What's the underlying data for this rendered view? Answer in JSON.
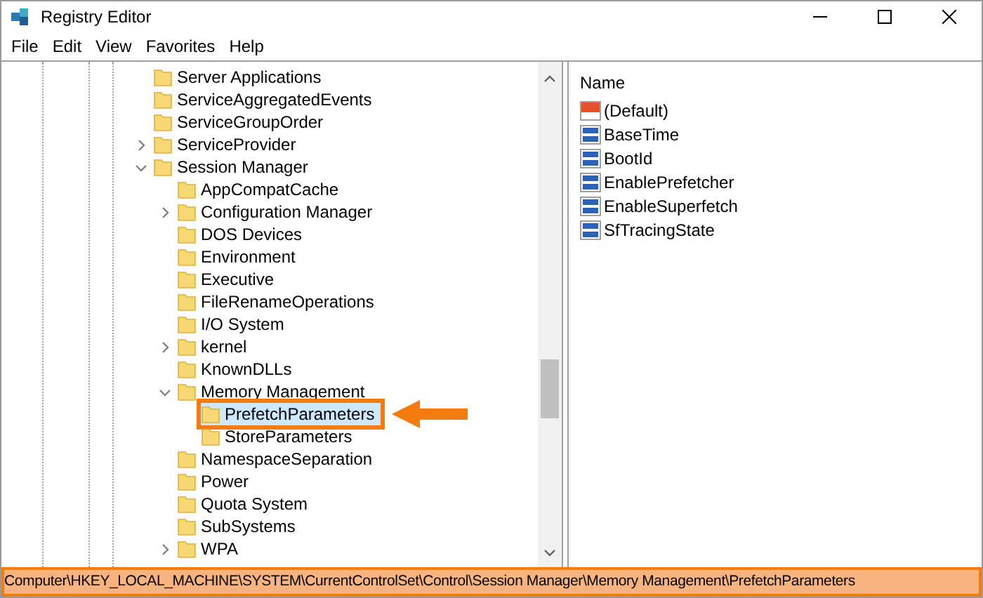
{
  "window": {
    "title": "Registry Editor"
  },
  "menu": [
    "File",
    "Edit",
    "View",
    "Favorites",
    "Help"
  ],
  "tree": [
    {
      "label": "Server Applications"
    },
    {
      "label": "ServiceAggregatedEvents"
    },
    {
      "label": "ServiceGroupOrder"
    },
    {
      "label": "ServiceProvider",
      "expanded": false
    },
    {
      "label": "Session Manager",
      "expanded": true,
      "children": [
        {
          "label": "AppCompatCache"
        },
        {
          "label": "Configuration Manager",
          "expanded": false
        },
        {
          "label": "DOS Devices"
        },
        {
          "label": "Environment"
        },
        {
          "label": "Executive"
        },
        {
          "label": "FileRenameOperations"
        },
        {
          "label": "I/O System"
        },
        {
          "label": "kernel",
          "expanded": false
        },
        {
          "label": "KnownDLLs"
        },
        {
          "label": "Memory Management",
          "expanded": true,
          "children": [
            {
              "label": "PrefetchParameters",
              "selected": true
            },
            {
              "label": "StoreParameters",
              "selected": false
            }
          ]
        },
        {
          "label": "NamespaceSeparation"
        },
        {
          "label": "Power"
        },
        {
          "label": "Quota System"
        },
        {
          "label": "SubSystems"
        },
        {
          "label": "WPA",
          "expanded": false
        }
      ]
    }
  ],
  "values": {
    "column": "Name",
    "rows": [
      {
        "kind": "string",
        "name": "(Default)"
      },
      {
        "kind": "binary",
        "name": "BaseTime"
      },
      {
        "kind": "binary",
        "name": "BootId"
      },
      {
        "kind": "binary",
        "name": "EnablePrefetcher"
      },
      {
        "kind": "binary",
        "name": "EnableSuperfetch"
      },
      {
        "kind": "binary",
        "name": "SfTracingState"
      }
    ]
  },
  "status_bar": {
    "text": "Computer\\HKEY_LOCAL_MACHINE\\SYSTEM\\CurrentControlSet\\Control\\Session Manager\\Memory Management\\PrefetchParameters",
    "highlighted": true
  }
}
